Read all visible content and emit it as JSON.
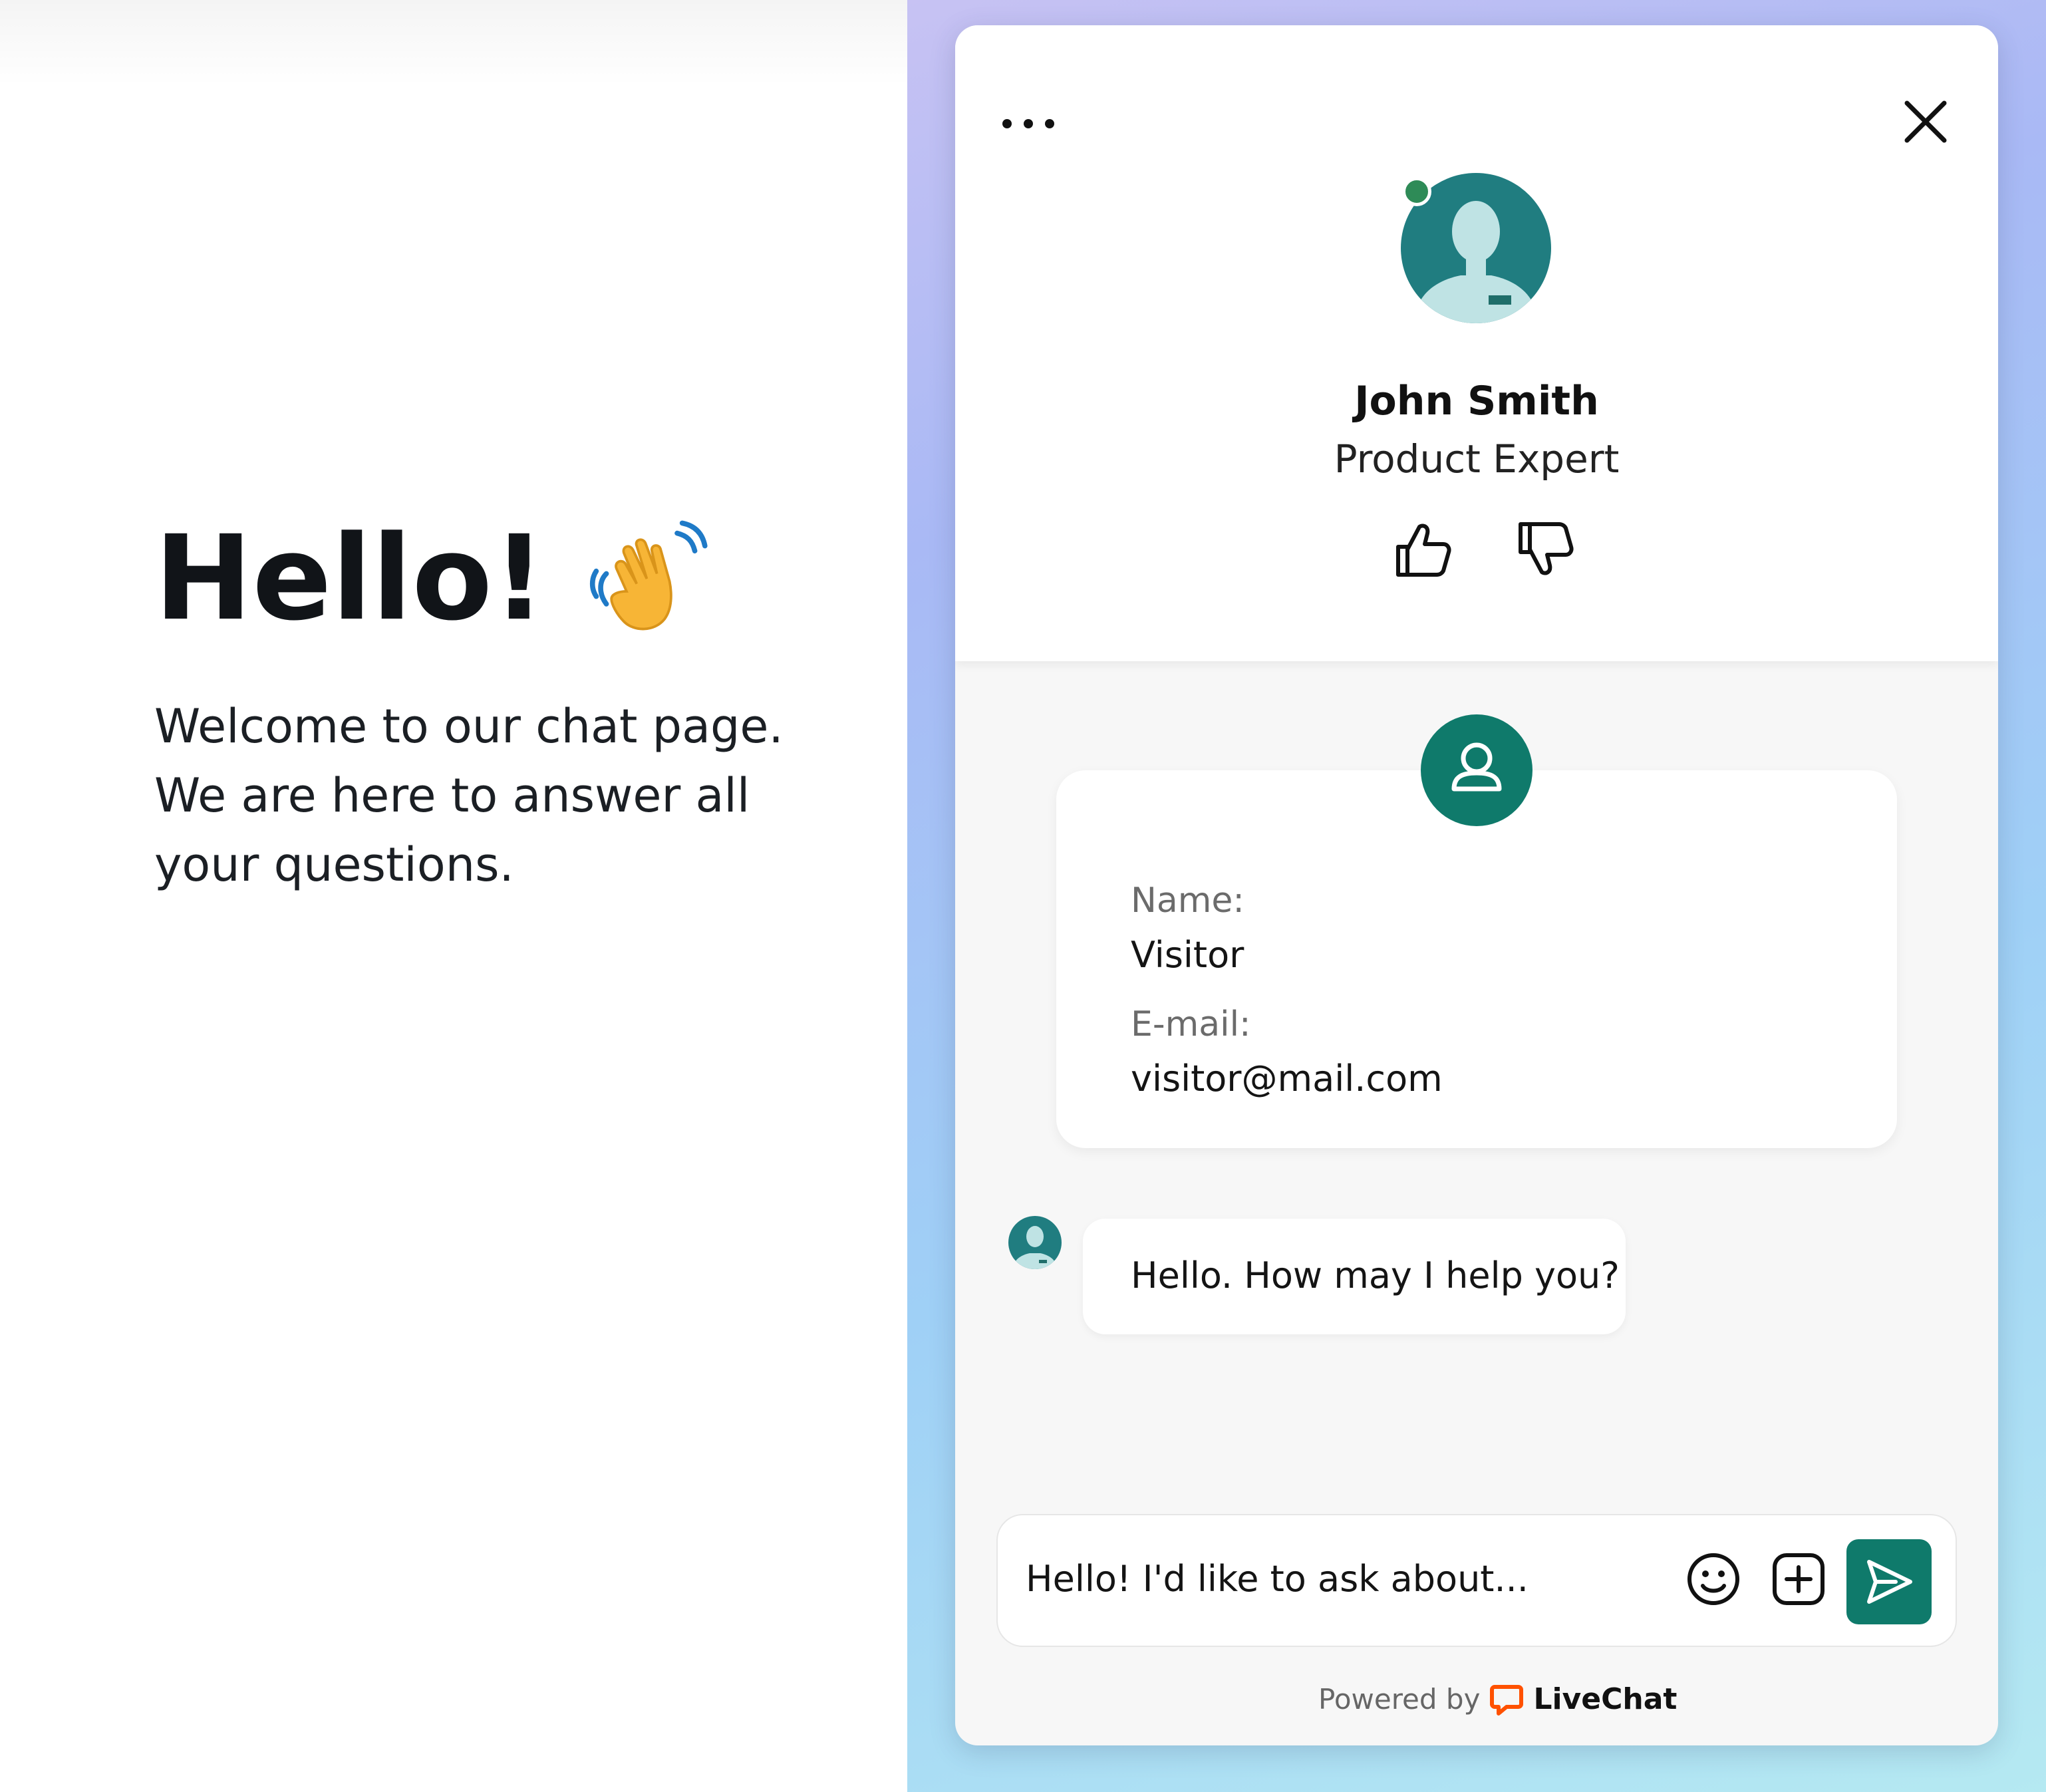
{
  "page": {
    "title": "Hello!",
    "welcome_text": "Welcome to our chat page. We are here to answer all your questions."
  },
  "chat": {
    "agent": {
      "name": "John Smith",
      "role": "Product Expert",
      "status": "online"
    },
    "rating": {
      "like_icon": "thumbs-up-icon",
      "dislike_icon": "thumbs-down-icon"
    },
    "visitor_form": {
      "name_label": "Name:",
      "name_value": "Visitor",
      "email_label": "E-mail:",
      "email_value": "visitor@mail.com"
    },
    "messages": [
      {
        "author": "agent",
        "text": "Hello. How may I help you?"
      }
    ],
    "composer": {
      "value": "Hello! I'd like to ask about..."
    },
    "footer": {
      "powered_by": "Powered by",
      "brand": "LiveChat"
    }
  },
  "colors": {
    "accent": "#0f7a6b",
    "status_online": "#2e8b57",
    "brand_orange": "#ff5100"
  }
}
